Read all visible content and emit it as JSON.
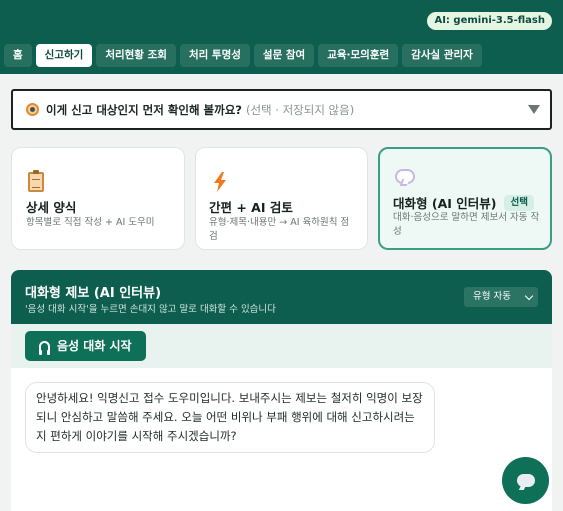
{
  "header": {
    "model_badge": "AI: gemini-3.5-flash",
    "nav_tabs": [
      {
        "label": "홈",
        "active": false
      },
      {
        "label": "신고하기",
        "active": true
      },
      {
        "label": "처리현황 조회",
        "active": false
      },
      {
        "label": "처리 투명성",
        "active": false
      },
      {
        "label": "설문 참여",
        "active": false
      },
      {
        "label": "교육·모의훈련",
        "active": false
      },
      {
        "label": "감사실 관리자",
        "active": false
      }
    ]
  },
  "target_check": {
    "question": "이게 신고 대상인지 먼저 확인해 볼까요?",
    "note": "(선택 · 저장되지 않음)"
  },
  "mode_cards": [
    {
      "icon": "clipboard-icon",
      "title": "상세 양식",
      "desc": "항목별로 직접 작성 + AI 도우미",
      "selected": false
    },
    {
      "icon": "lightning-icon",
      "title": "간편 + AI 검토",
      "desc": "유형·제목·내용만 → AI 육하원칙 점검",
      "selected": false
    },
    {
      "icon": "speech-bubble-icon",
      "title": "대화형 (AI 인터뷰)",
      "desc": "대화·음성으로 말하면 제보서 자동 작성",
      "selected": true,
      "badge": "선택"
    }
  ],
  "chat_panel": {
    "title": "대화형 제보 (AI 인터뷰)",
    "subtitle": "'음성 대화 시작'을 누르면 손대지 않고 말로 대화할 수 있습니다",
    "select_value": "유형 자동",
    "voice_button_label": "음성 대화 시작",
    "messages": [
      {
        "role": "assistant",
        "text": "안녕하세요!              익명신고 접수 도우미입니다. 보내주시는 제보는 철저히 익명이 보장되니 안심하고 말씀해 주세요. 오늘 어떤 비위나 부패 행위에 대해 신고하시려는지 편하게 이야기를 시작해 주시겠습니까?"
      }
    ]
  },
  "colors": {
    "brand": "#0e5e4f",
    "accent": "#0e7058",
    "selected_border": "#3b9d84"
  }
}
